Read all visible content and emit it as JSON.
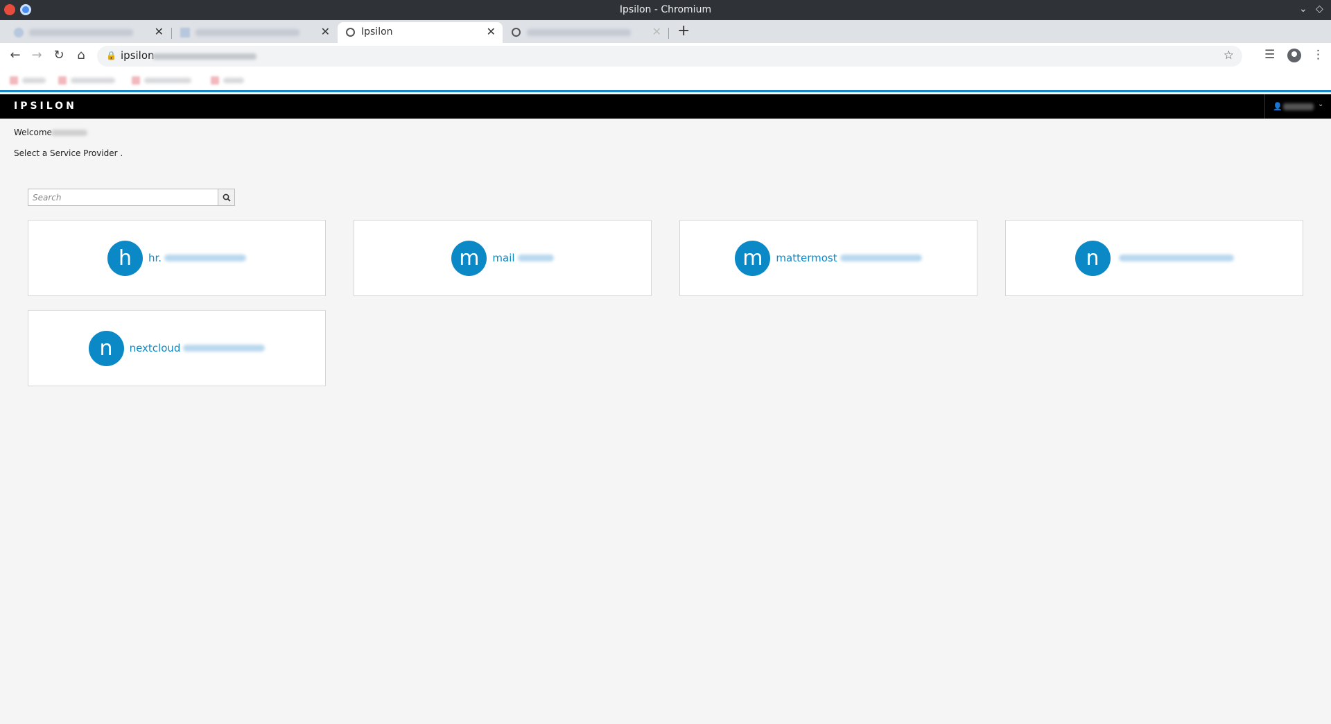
{
  "window": {
    "title": "Ipsilon - Chromium"
  },
  "tabs": [
    {
      "label": "",
      "active": false
    },
    {
      "label": "",
      "active": false
    },
    {
      "label": "Ipsilon",
      "active": true
    },
    {
      "label": "",
      "active": false
    }
  ],
  "toolbar": {
    "url": "ipsilon"
  },
  "navbar": {
    "brand": "IPSILON"
  },
  "content": {
    "welcome": "Welcome",
    "instruction": "Select a Service Provider ."
  },
  "search": {
    "placeholder": "Search"
  },
  "providers": [
    {
      "letter": "h",
      "name": "hr."
    },
    {
      "letter": "m",
      "name": "mail"
    },
    {
      "letter": "m",
      "name": "mattermost"
    },
    {
      "letter": "n",
      "name": ""
    },
    {
      "letter": "n",
      "name": "nextcloud"
    }
  ],
  "colors": {
    "accent": "#0b88c6",
    "navbar": "#000000",
    "page_bg": "#f5f5f5"
  }
}
